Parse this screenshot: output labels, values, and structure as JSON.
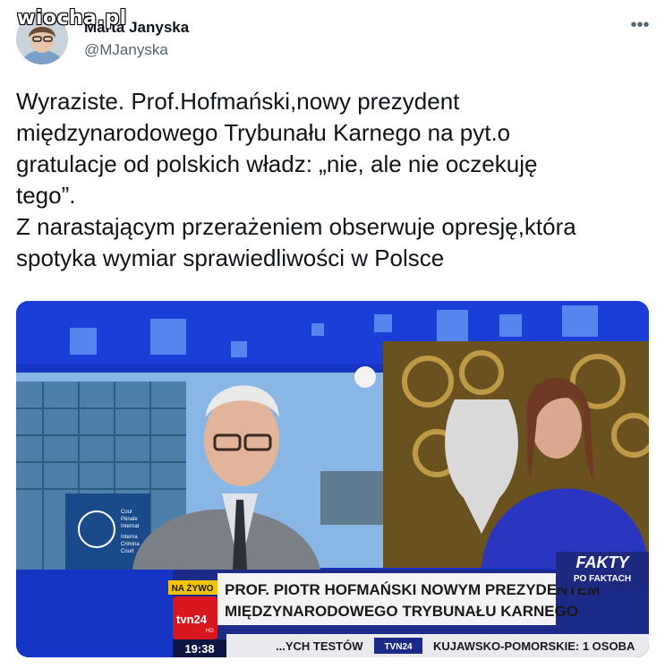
{
  "watermark": {
    "text": "wiocha.pl"
  },
  "author": {
    "display_name": "Marta Janyska",
    "handle": "@MJanyska"
  },
  "tweet": {
    "text": "Wyraziste. Prof.Hofmański,nowy prezydent\nmiędzynarodowego Trybunału Karnego na pyt.o\ngratulacje od polskich władz: „nie, ale nie oczekuję\ntego”.\nZ narastającym przerażeniem obserwuje opresję,która\nspotyka wymiar sprawiedliwości w Polsce"
  },
  "media": {
    "lower_third": {
      "badge": "NA ŻYWO",
      "headline_line1": "PROF. PIOTR HOFMAŃSKI NOWYM PREZYDENTEM",
      "headline_line2": "MIĘDZYNARODOWEGO TRYBUNAŁU KARNEGO",
      "channel_logo": "tvn24",
      "channel_sub": "HD",
      "time": "19:38",
      "ticker_left": "...YCH TESTÓW",
      "ticker_channel": "TVN24",
      "ticker_right": "KUJAWSKO-POMORSKIE: 1 OSOBA",
      "program_title": "FAKTY",
      "program_subtitle": "PO FAKTACH",
      "building_sign_lines": [
        "Cour",
        "Pénale",
        "Internat",
        "Interna",
        "Crimina",
        "Court"
      ]
    },
    "colors": {
      "studio_blue": "#1b3ed8",
      "lower_third_red": "#d8181e",
      "lower_third_white": "#f4f4f6"
    }
  },
  "icons": {
    "more": "more-horizontal-icon"
  }
}
